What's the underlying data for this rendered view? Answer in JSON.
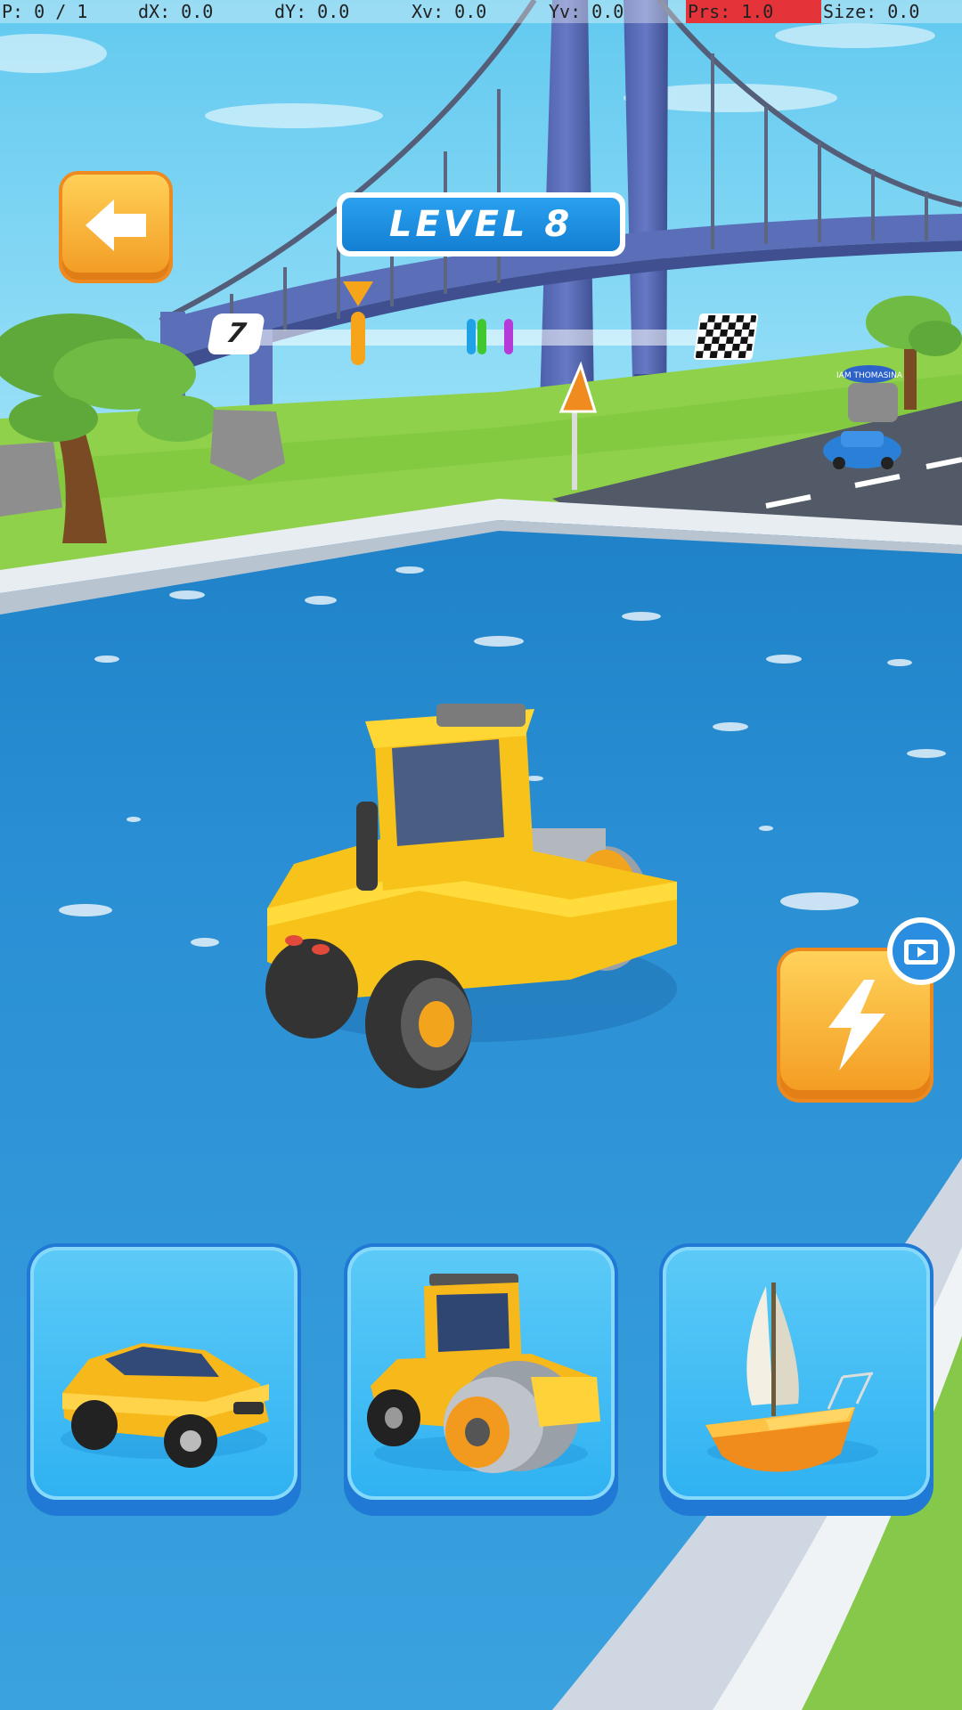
{
  "debug": {
    "pointer": "P: 0 / 1",
    "dx": "dX: 0.0",
    "dy": "dY: 0.0",
    "xv": "Xv: 0.0",
    "yv": "Yv: 0.0",
    "prs": "Prs: 1.0",
    "size": "Size: 0.0"
  },
  "header": {
    "level_title": "LEVEL  8",
    "back_icon": "arrow-left-icon"
  },
  "progress": {
    "current_level": "7",
    "player_progress": 0.27,
    "rival_colors": [
      "#1fa3e6",
      "#41c72f",
      "#b53ad8"
    ],
    "player_color": "#f6a419",
    "finish_icon": "checkered-flag-icon"
  },
  "scene": {
    "sign_text": "IAM THOMASINA",
    "vehicle": "road-roller"
  },
  "boost": {
    "icon": "lightning-icon",
    "badge_icon": "video-icon"
  },
  "vehicle_choices": [
    {
      "name": "car",
      "icon": "sports-car-icon"
    },
    {
      "name": "road-roller",
      "icon": "road-roller-icon"
    },
    {
      "name": "boat",
      "icon": "sailboat-icon"
    }
  ],
  "colors": {
    "water": "#2a8fd4",
    "accent_orange": "#f39a20",
    "card_blue": "#3fbcf4"
  }
}
